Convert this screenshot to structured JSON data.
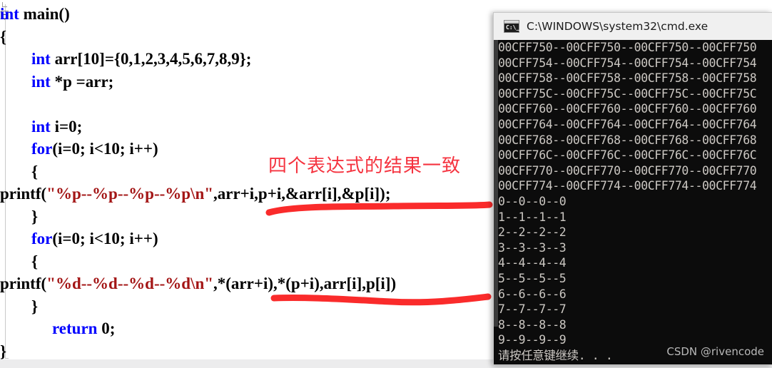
{
  "editor": {
    "name": "code-editor",
    "background": "#ffffff",
    "keyword_color": "#0000ff",
    "string_color": "#a31515",
    "text_color": "#000000",
    "lines": [
      {
        "indent": 0,
        "tokens": [
          {
            "t": "int",
            "c": "kw"
          },
          {
            "t": " main()",
            "c": ""
          }
        ]
      },
      {
        "indent": 0,
        "tokens": [
          {
            "t": "{",
            "c": ""
          }
        ]
      },
      {
        "indent": 2,
        "tokens": [
          {
            "t": "int",
            "c": "kw"
          },
          {
            "t": " arr[10]={0,1,2,3,4,5,6,7,8,9};",
            "c": ""
          }
        ]
      },
      {
        "indent": 2,
        "tokens": [
          {
            "t": "int",
            "c": "kw"
          },
          {
            "t": " *p =arr;",
            "c": ""
          }
        ]
      },
      {
        "indent": 0,
        "tokens": []
      },
      {
        "indent": 2,
        "tokens": [
          {
            "t": "int",
            "c": "kw"
          },
          {
            "t": " i=0;",
            "c": ""
          }
        ]
      },
      {
        "indent": 2,
        "tokens": [
          {
            "t": "for",
            "c": "kw"
          },
          {
            "t": "(i=0; i<10; i++)",
            "c": ""
          }
        ]
      },
      {
        "indent": 2,
        "tokens": [
          {
            "t": "{",
            "c": ""
          }
        ]
      },
      {
        "indent": 0,
        "tokens": [
          {
            "t": "printf(",
            "c": ""
          },
          {
            "t": "\"%p--%p--%p--%p\\n\"",
            "c": "str"
          },
          {
            "t": ",arr+i,p+i,&arr[i],&p[i]);",
            "c": ""
          }
        ]
      },
      {
        "indent": 2,
        "tokens": [
          {
            "t": "}",
            "c": ""
          }
        ]
      },
      {
        "indent": 2,
        "tokens": [
          {
            "t": "for",
            "c": "kw"
          },
          {
            "t": "(i=0; i<10; i++)",
            "c": ""
          }
        ]
      },
      {
        "indent": 2,
        "tokens": [
          {
            "t": "{",
            "c": ""
          }
        ]
      },
      {
        "indent": 0,
        "tokens": [
          {
            "t": "printf(",
            "c": ""
          },
          {
            "t": "\"%d--%d--%d--%d\\n\"",
            "c": "str"
          },
          {
            "t": ",*(arr+i),*(p+i),arr[i],p[i])",
            "c": ""
          }
        ]
      },
      {
        "indent": 2,
        "tokens": [
          {
            "t": "}",
            "c": ""
          }
        ]
      },
      {
        "indent": 3,
        "tokens": [
          {
            "t": "return",
            "c": "kw"
          },
          {
            "t": " 0;",
            "c": ""
          }
        ]
      },
      {
        "indent": 0,
        "tokens": [
          {
            "t": "}",
            "c": ""
          }
        ]
      }
    ]
  },
  "annotations": {
    "note_text": "四个表达式的结果一致",
    "note_color": "#f5333f",
    "underline_color": "#fa2b2b",
    "underline_count": 2
  },
  "console": {
    "title": "C:\\WINDOWS\\system32\\cmd.exe",
    "icon": "cmd-icon",
    "icon_prompt": "C:\\_",
    "background": "#0c0c0c",
    "text_color": "#ccc8c3",
    "lines": [
      "00CFF750--00CFF750--00CFF750--00CFF750",
      "00CFF754--00CFF754--00CFF754--00CFF754",
      "00CFF758--00CFF758--00CFF758--00CFF758",
      "00CFF75C--00CFF75C--00CFF75C--00CFF75C",
      "00CFF760--00CFF760--00CFF760--00CFF760",
      "00CFF764--00CFF764--00CFF764--00CFF764",
      "00CFF768--00CFF768--00CFF768--00CFF768",
      "00CFF76C--00CFF76C--00CFF76C--00CFF76C",
      "00CFF770--00CFF770--00CFF770--00CFF770",
      "00CFF774--00CFF774--00CFF774--00CFF774",
      "0--0--0--0",
      "1--1--1--1",
      "2--2--2--2",
      "3--3--3--3",
      "4--4--4--4",
      "5--5--5--5",
      "6--6--6--6",
      "7--7--7--7",
      "8--8--8--8",
      "9--9--9--9",
      "请按任意键继续. . ."
    ]
  },
  "watermark": {
    "text": "CSDN @rivencode"
  }
}
